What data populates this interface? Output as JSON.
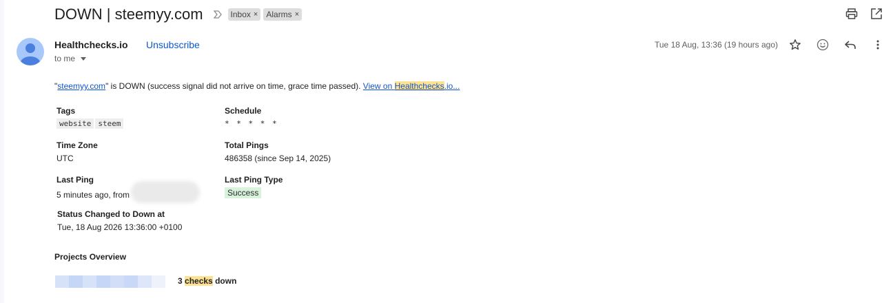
{
  "email": {
    "subject": "DOWN | steemyy.com",
    "labels": [
      {
        "name": "Inbox",
        "close": "×"
      },
      {
        "name": "Alarms",
        "close": "×"
      }
    ],
    "sender": "Healthchecks.io",
    "unsubscribe_label": "Unsubscribe",
    "to_label": "to me",
    "date": "Tue 18 Aug, 13:36 (19 hours ago)"
  },
  "body": {
    "quote_open": "\"",
    "site_link": "steemyy.com",
    "message_text": "\" is DOWN (success signal did not arrive on time, grace time passed). ",
    "view_link_prefix": "View on ",
    "view_link_highlight": "Healthchecks",
    "view_link_suffix": ".io..."
  },
  "details": {
    "tags_label": "Tags",
    "tags": [
      "website",
      "steem"
    ],
    "schedule_label": "Schedule",
    "schedule_value": "* * * * *",
    "timezone_label": "Time Zone",
    "timezone_value": "UTC",
    "total_pings_label": "Total Pings",
    "total_pings_value": "486358 (since Sep 14, 2025)",
    "last_ping_label": "Last Ping",
    "last_ping_value": "5 minutes ago, from",
    "last_ping_type_label": "Last Ping Type",
    "last_ping_type_value": "Success",
    "status_changed_label": "Status Changed to Down at",
    "status_changed_value": "Tue, 18 Aug 2026 13:36:00 +0100"
  },
  "projects": {
    "title": "Projects Overview",
    "checks_count": "3",
    "checks_word": "checks",
    "checks_suffix": "down"
  },
  "icons": {
    "print": "print-icon",
    "open_new_window": "open-in-new-window-icon",
    "star": "star-icon",
    "emoji": "emoji-reaction-icon",
    "reply": "reply-icon",
    "more": "more-vertical-icon",
    "importance": "importance-marker-icon"
  },
  "colors": {
    "link": "#1155cc",
    "unsubscribe": "#0b57d0",
    "highlight": "#fde293",
    "success_badge": "#d9f2dc",
    "avatar": "#a8c7fa"
  }
}
